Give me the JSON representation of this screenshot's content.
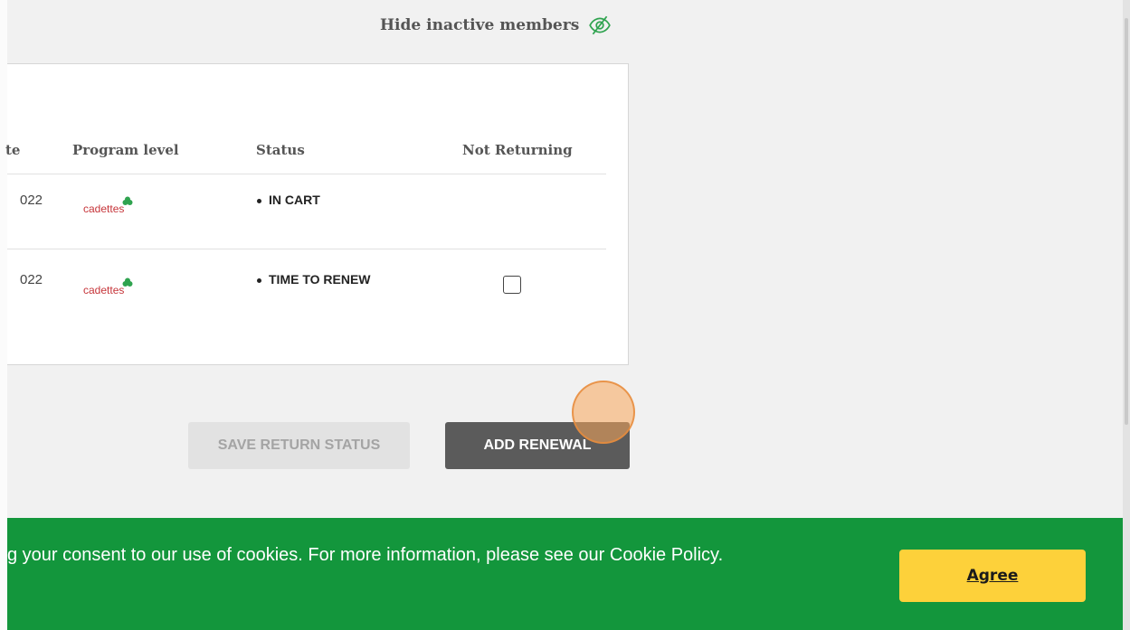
{
  "filters": {
    "hide_inactive_label": "Hide inactive members",
    "hide_inactive_icon": "eye-slash-icon"
  },
  "table": {
    "columns": [
      "te",
      "Program level",
      "Status",
      "Not Returning"
    ],
    "rows": [
      {
        "date": "022",
        "program_level": "cadettes",
        "status": "IN CART",
        "not_returning_checkbox": false
      },
      {
        "date": "022",
        "program_level": "cadettes",
        "status": "TIME TO RENEW",
        "not_returning_checkbox": true
      }
    ]
  },
  "actions": {
    "save_return_status": "SAVE RETURN STATUS",
    "add_renewal": "ADD RENEWAL"
  },
  "cookie_banner": {
    "text": "g your consent to our use of cookies. For more information, please see our Cookie Policy.",
    "agree_label": "Agree"
  },
  "colors": {
    "accent_green": "#13963c",
    "agree_yellow": "#fdd13a",
    "logo_red": "#c6353a"
  }
}
